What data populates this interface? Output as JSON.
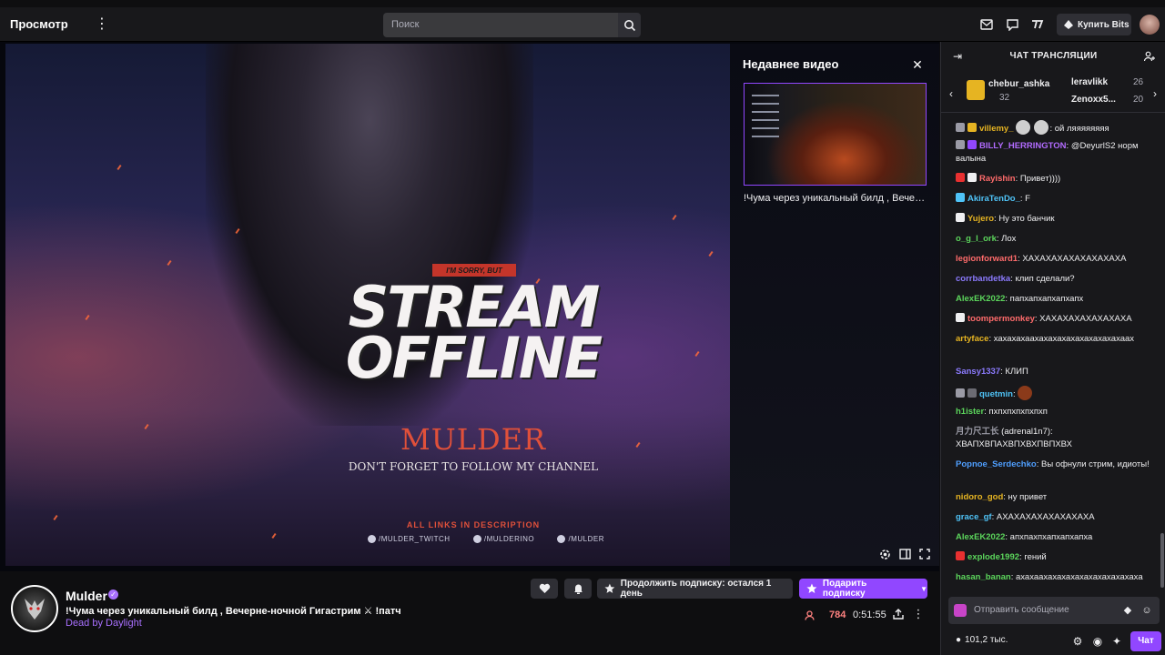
{
  "topbar": {
    "brand": "Просмотр",
    "search_placeholder": "Поиск",
    "buy_bits": "Купить Bits"
  },
  "player": {
    "poster": {
      "sorry": "I'M SORRY, BUT",
      "title_line1": "STREAM",
      "title_line2": "OFFLINE",
      "streamer": "MULDER",
      "follow": "DON'T FORGET TO FOLLOW MY CHANNEL",
      "links_title": "ALL LINKS IN DESCRIPTION",
      "socials": [
        "/MULDER_TWITCH",
        "/MULDERINO",
        "/MULDER"
      ]
    },
    "recent": {
      "title": "Недавнее видео",
      "caption": "!Чума через уникальный билд , Вечерне-ночной Гигастрим"
    }
  },
  "channel": {
    "name": "Mulder",
    "stream_title": "!Чума через уникальный билд , Вечерне-ночной Гигастрим ⚔ !патч",
    "game": "Dead by Daylight",
    "continue_sub": "Продолжить подписку: остался 1 день",
    "gift_sub": "Подарить подписку",
    "viewers": "784",
    "uptime": "0:51:55"
  },
  "chat": {
    "header": "ЧАТ ТРАНСЛЯЦИИ",
    "gifters": [
      {
        "name": "chebur_ashka",
        "count": "32"
      },
      {
        "name": "leravlikk",
        "count": "26"
      },
      {
        "name": "Zenoxx5...",
        "count": "20"
      }
    ],
    "messages": [
      {
        "user": "villemy_",
        "color": "#e6b422",
        "text": ": ой ляяяяяяяя"
      },
      {
        "user": "BILLY_HERRINGTON",
        "color": "#b26bff",
        "text": ": @DeyurlS2 норм валына"
      },
      {
        "user": "Rayishin",
        "color": "#ff6b6b",
        "text": ": Привет))))"
      },
      {
        "user": "AkiraTenDo_",
        "color": "#4fc3f7",
        "text": ": F"
      },
      {
        "user": "Yujero",
        "color": "#e6b422",
        "text": ": Ну это банчик"
      },
      {
        "user": "o_g_l_ork",
        "color": "#5cd65c",
        "text": ": Лох"
      },
      {
        "user": "legionforward1",
        "color": "#ff6b6b",
        "text": ": ХАХАХАХАХАХАХАХАХА"
      },
      {
        "user": "corrbandetka",
        "color": "#8c7bff",
        "text": ": клип сделали?"
      },
      {
        "user": "AlexEK2022",
        "color": "#5cd65c",
        "text": ": папхапхапхапхапх"
      },
      {
        "user": "toompermonkey",
        "color": "#ff6b6b",
        "text": ": ХАХАХАХАХАХАХАХА"
      },
      {
        "user": "artyface",
        "color": "#e6b422",
        "text": ": хахахахаахахахахахахахахахахаах"
      },
      {
        "user": "Sansy1337",
        "color": "#8c7bff",
        "text": ": КЛИП"
      },
      {
        "user": "quetmin",
        "color": "#4fc3f7",
        "text": ":"
      },
      {
        "user": "h1ister",
        "color": "#5cd65c",
        "text": ": пхпхпхпхпхпхп"
      },
      {
        "user": "月力尺工长",
        "color": "#9a9aa5",
        "text": " (adrenal1n7): ХВАПХВПАХВПХВХПВПХВХ"
      },
      {
        "user": "Popnoe_Serdechko",
        "color": "#4f9fff",
        "text": ": Вы офнули стрим, идиоты!"
      },
      {
        "user": "nidoro_god",
        "color": "#e6b422",
        "text": ": ну привет"
      },
      {
        "user": "grace_gf",
        "color": "#4fc3f7",
        "text": ": АХАХАХАХАХАХАХАХА"
      },
      {
        "user": "AlexEK2022",
        "color": "#5cd65c",
        "text": ": апхпахпхапхапхапха"
      },
      {
        "user": "explode1992",
        "color": "#5cd65c",
        "text": ": гений"
      },
      {
        "user": "hasan_banan",
        "color": "#5cd65c",
        "text": ": ахахаахахахахахахахахахахаха"
      }
    ],
    "input_placeholder": "Отправить сообщение",
    "viewers_total": "101,2 тыс.",
    "chat_button": "Чат"
  }
}
